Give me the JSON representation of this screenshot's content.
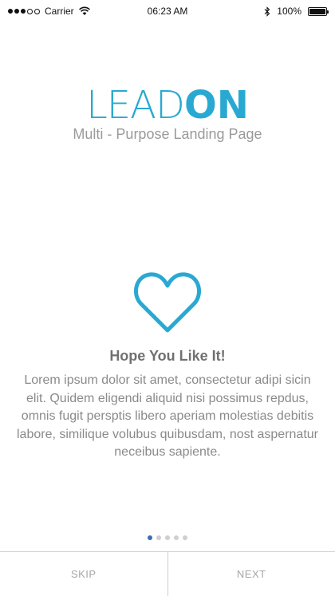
{
  "status_bar": {
    "carrier": "Carrier",
    "time": "06:23 AM",
    "battery_text": "100%",
    "battery_level": 1.0,
    "signal_icon": "signal-dots-icon",
    "wifi_icon": "wifi-icon",
    "bluetooth_icon": "bluetooth-icon",
    "battery_icon": "battery-icon"
  },
  "logo": {
    "part_thin": "LEAD",
    "part_bold": "ON",
    "color": "#29a9d2"
  },
  "tagline": "Multi - Purpose Landing Page",
  "feature": {
    "icon": "heart-icon",
    "headline": "Hope You Like It!",
    "body": "Lorem ipsum dolor sit amet, consectetur adipi sicin elit. Quidem eligendi aliquid nisi possimus repdus, omnis fugit persptis libero aperiam molestias debitis labore, similique volubus quibusdam, nost aspernatur neceibus sapiente."
  },
  "pager": {
    "total": 5,
    "active_index": 0,
    "active_color": "#3a6fb3"
  },
  "buttons": {
    "skip": "SKIP",
    "next": "NEXT"
  }
}
